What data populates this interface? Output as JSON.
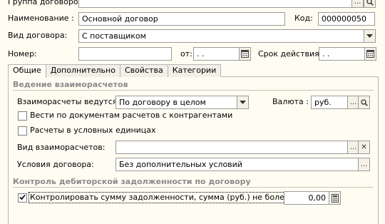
{
  "header": {
    "group_label": "Группа договоров:",
    "group_value": "",
    "name_label": "Наименование :",
    "name_value": "Основной договор",
    "code_label": "Код:",
    "code_value": "000000050",
    "type_label": "Вид договора:",
    "type_value": "С поставщиком",
    "number_label": "Номер:",
    "number_value": "",
    "from_label": "от:",
    "from_value": " .  .",
    "valid_label": "Срок действия:",
    "valid_value": " .  ."
  },
  "tabs": [
    {
      "label": "Общие",
      "active": true
    },
    {
      "label": "Дополнительно",
      "active": false
    },
    {
      "label": "Свойства",
      "active": false
    },
    {
      "label": "Категории",
      "active": false
    }
  ],
  "general": {
    "section1_title": "Ведение взаиморасчетов",
    "settlements_label": "Взаиморасчеты ведутся:",
    "settlements_value": "По договору в целом",
    "currency_label": "Валюта :",
    "currency_value": "руб.",
    "cb_docs_label": "Вести по документам расчетов с контрагентами",
    "cb_docs_checked": false,
    "cb_units_label": "Расчеты в условных единицах",
    "cb_units_checked": false,
    "settlement_kind_label": "Вид взаиморасчетов:",
    "settlement_kind_value": "",
    "terms_label": "Условия договора:",
    "terms_value": "Без дополнительных условий",
    "section2_title": "Контроль дебиторской задолженности по договору",
    "cb_control_label": "Контролировать сумму задолженности, сумма (руб.) не более",
    "cb_control_checked": true,
    "limit_value": "0,00"
  },
  "buttons": {
    "ellipsis": "...",
    "clear": "✕"
  },
  "colors": {
    "background": "#fffdf2",
    "section_title": "#8a8a8a",
    "border": "#9a9a9a"
  }
}
